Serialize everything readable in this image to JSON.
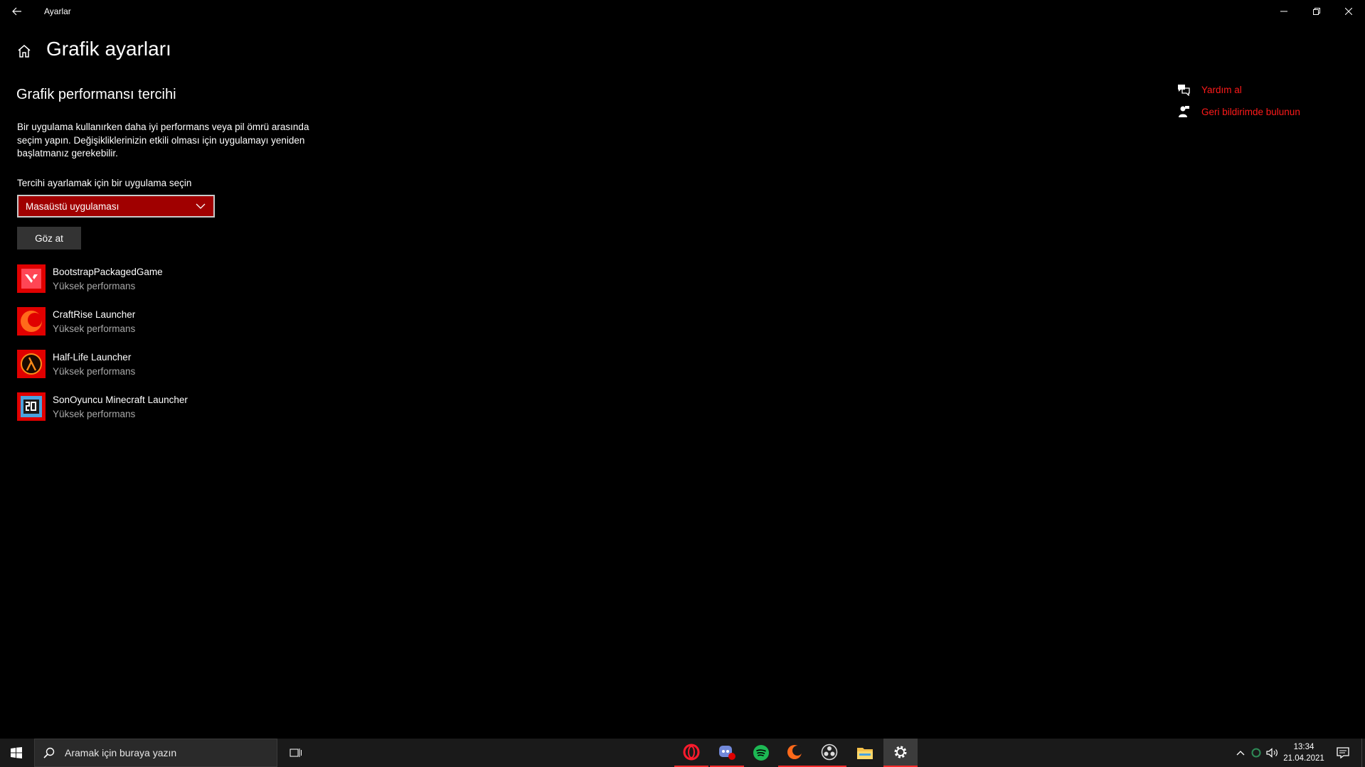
{
  "window": {
    "title": "Ayarlar"
  },
  "header": {
    "title": "Grafik ayarları"
  },
  "section": {
    "title": "Grafik performansı tercihi",
    "description": "Bir uygulama kullanırken daha iyi performans veya pil ömrü arasında seçim yapın. Değişikliklerinizin etkili olması için uygulamayı yeniden başlatmanız gerekebilir.",
    "select_label": "Tercihi ayarlamak için bir uygulama seçin",
    "select_value": "Masaüstü uygulaması",
    "browse_label": "Göz at"
  },
  "apps": [
    {
      "name": "BootstrapPackagedGame",
      "preference": "Yüksek performans",
      "icon": "valorant-icon"
    },
    {
      "name": "CraftRise Launcher",
      "preference": "Yüksek performans",
      "icon": "craftrise-icon"
    },
    {
      "name": "Half-Life Launcher",
      "preference": "Yüksek performans",
      "icon": "half-life-icon"
    },
    {
      "name": "SonOyuncu Minecraft Launcher",
      "preference": "Yüksek performans",
      "icon": "sonoyuncu-icon"
    }
  ],
  "side_links": {
    "help": "Yardım al",
    "feedback": "Geri bildirimde bulunun"
  },
  "taskbar": {
    "search_placeholder": "Aramak için buraya yazın",
    "pinned": [
      "opera-icon",
      "discord-icon",
      "spotify-icon",
      "craftrise-icon",
      "obs-icon",
      "file-explorer-icon",
      "settings-icon"
    ],
    "time": "13:34",
    "date": "21.04.2021"
  },
  "colors": {
    "accent": "#e00000",
    "link": "#ff1a1a",
    "select_bg": "#a00000",
    "background": "#000000"
  }
}
